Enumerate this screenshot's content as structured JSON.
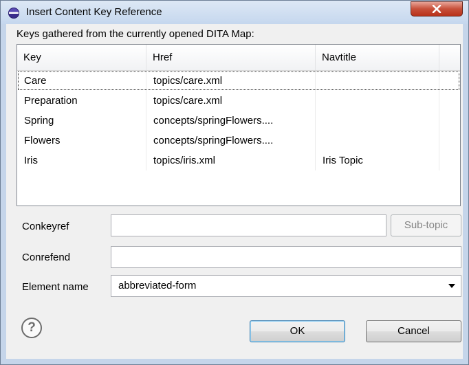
{
  "window": {
    "title": "Insert Content Key Reference"
  },
  "keys_label": "Keys gathered from the currently opened DITA Map:",
  "table": {
    "columns": [
      "Key",
      "Href",
      "Navtitle"
    ],
    "rows": [
      {
        "key": "Care",
        "href": "topics/care.xml",
        "navtitle": ""
      },
      {
        "key": "Preparation",
        "href": "topics/care.xml",
        "navtitle": ""
      },
      {
        "key": "Spring",
        "href": "concepts/springFlowers....",
        "navtitle": ""
      },
      {
        "key": "Flowers",
        "href": "concepts/springFlowers....",
        "navtitle": ""
      },
      {
        "key": "Iris",
        "href": "topics/iris.xml",
        "navtitle": "Iris Topic"
      }
    ]
  },
  "form": {
    "conkeyref_label": "Conkeyref",
    "conkeyref_value": "",
    "subtopic_label": "Sub-topic",
    "conrefend_label": "Conrefend",
    "conrefend_value": "",
    "element_name_label": "Element name",
    "element_name_value": "abbreviated-form"
  },
  "buttons": {
    "help": "?",
    "ok": "OK",
    "cancel": "Cancel"
  },
  "icons": {
    "window": "app-globe-icon",
    "close": "close-icon",
    "dropdown": "chevron-down-icon",
    "help": "help-icon"
  }
}
